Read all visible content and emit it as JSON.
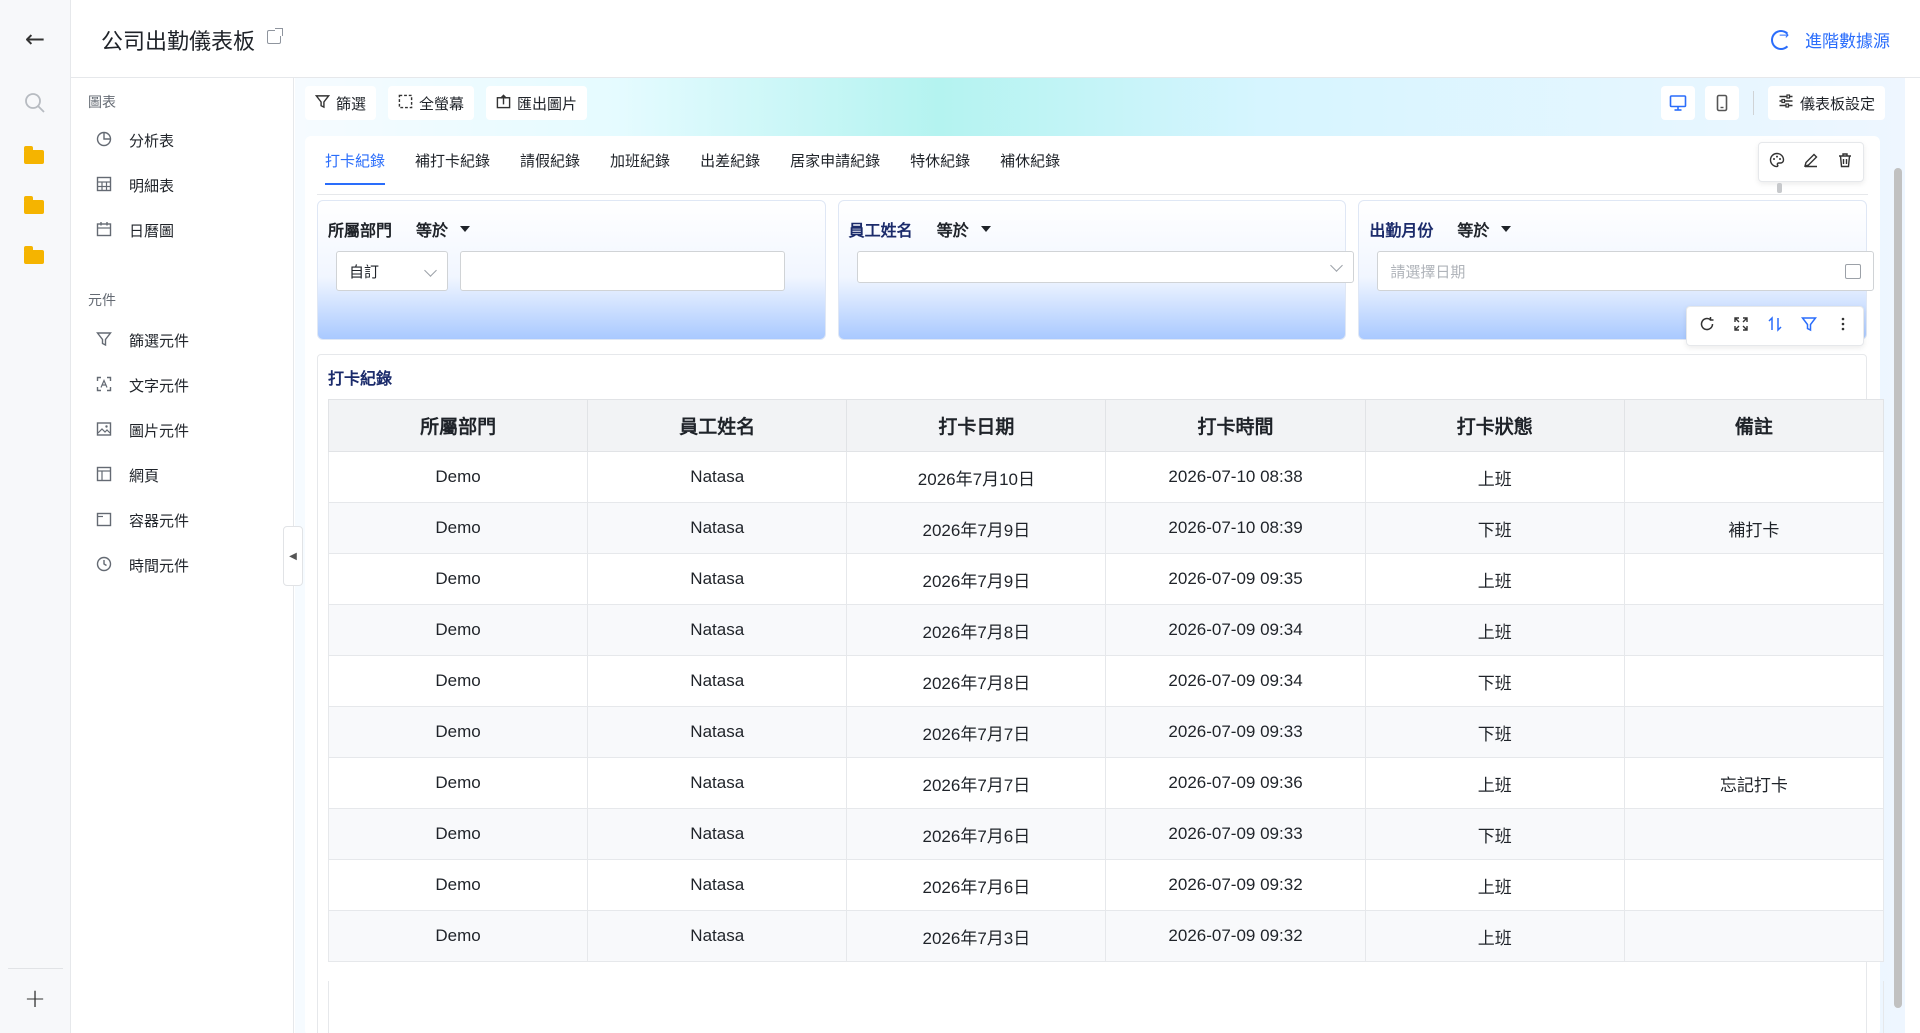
{
  "header": {
    "title": "公司出勤儀表板",
    "advanced_source": "進階數據源"
  },
  "sidebar": {
    "group_charts": "圖表",
    "charts": [
      {
        "label": "分析表",
        "icon": "pie-chart-icon"
      },
      {
        "label": "明細表",
        "icon": "table-icon"
      },
      {
        "label": "日曆圖",
        "icon": "calendar-icon"
      }
    ],
    "group_components": "元件",
    "components": [
      {
        "label": "篩選元件",
        "icon": "filter-icon"
      },
      {
        "label": "文字元件",
        "icon": "text-icon"
      },
      {
        "label": "圖片元件",
        "icon": "image-icon"
      },
      {
        "label": "網頁",
        "icon": "webpage-icon"
      },
      {
        "label": "容器元件",
        "icon": "container-icon"
      },
      {
        "label": "時間元件",
        "icon": "clock-icon"
      }
    ]
  },
  "toolbar": {
    "filter": "篩選",
    "fullscreen": "全螢幕",
    "export_image": "匯出圖片",
    "dashboard_settings": "儀表板設定"
  },
  "tabs": [
    "打卡紀錄",
    "補打卡紀錄",
    "請假紀錄",
    "加班紀錄",
    "出差紀錄",
    "居家申請紀錄",
    "特休紀錄",
    "補休紀錄"
  ],
  "filters": {
    "dept": {
      "label": "所屬部門",
      "op": "等於",
      "mode": "自訂",
      "value": ""
    },
    "employee": {
      "label": "員工姓名",
      "op": "等於",
      "value": ""
    },
    "month": {
      "label": "出勤月份",
      "op": "等於",
      "placeholder": "請選擇日期"
    }
  },
  "table": {
    "title": "打卡紀錄",
    "columns": [
      "所屬部門",
      "員工姓名",
      "打卡日期",
      "打卡時間",
      "打卡狀態",
      "備註"
    ],
    "rows": [
      [
        "Demo",
        "Natasa",
        "2026年7月10日",
        "2026-07-10 08:38",
        "上班",
        ""
      ],
      [
        "Demo",
        "Natasa",
        "2026年7月9日",
        "2026-07-10 08:39",
        "下班",
        "補打卡"
      ],
      [
        "Demo",
        "Natasa",
        "2026年7月9日",
        "2026-07-09 09:35",
        "上班",
        ""
      ],
      [
        "Demo",
        "Natasa",
        "2026年7月8日",
        "2026-07-09 09:34",
        "上班",
        ""
      ],
      [
        "Demo",
        "Natasa",
        "2026年7月8日",
        "2026-07-09 09:34",
        "下班",
        ""
      ],
      [
        "Demo",
        "Natasa",
        "2026年7月7日",
        "2026-07-09 09:33",
        "下班",
        ""
      ],
      [
        "Demo",
        "Natasa",
        "2026年7月7日",
        "2026-07-09 09:36",
        "上班",
        "忘記打卡"
      ],
      [
        "Demo",
        "Natasa",
        "2026年7月6日",
        "2026-07-09 09:33",
        "下班",
        ""
      ],
      [
        "Demo",
        "Natasa",
        "2026年7月6日",
        "2026-07-09 09:32",
        "上班",
        ""
      ],
      [
        "Demo",
        "Natasa",
        "2026年7月3日",
        "2026-07-09 09:32",
        "上班",
        ""
      ]
    ]
  },
  "colors": {
    "accent": "#2a6dfb",
    "folder": "#f5b400"
  }
}
